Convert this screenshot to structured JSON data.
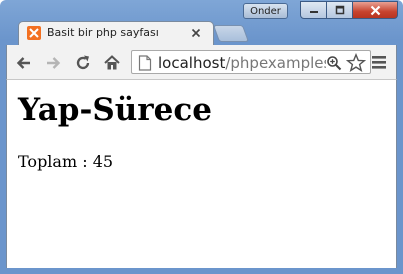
{
  "window": {
    "profile_name": "Onder"
  },
  "tab": {
    "title": "Basit bir php sayfası",
    "favicon": "xampp-icon"
  },
  "toolbar": {
    "url_host": "localhost",
    "url_rest": "/phpexamples",
    "icons": [
      "back-arrow-icon",
      "forward-arrow-icon",
      "reload-icon",
      "home-icon",
      "page-icon",
      "zoom-icon",
      "star-icon",
      "menu-icon"
    ]
  },
  "page": {
    "heading": "Yap-Sürece",
    "total_line": "Toplam : 45"
  },
  "colors": {
    "frame": "#6b95cc",
    "close_button": "#c7432e",
    "favicon": "#f37021"
  }
}
